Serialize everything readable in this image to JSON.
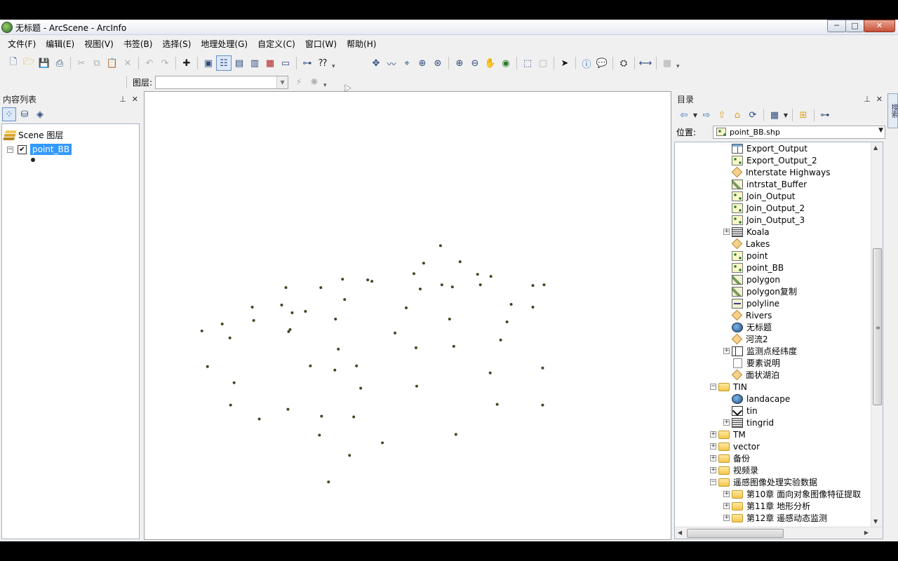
{
  "window": {
    "title": "无标题 - ArcScene - ArcInfo",
    "buttons": {
      "minimize": "─",
      "maximize": "□",
      "close": "✕"
    }
  },
  "menu": [
    "文件(F)",
    "编辑(E)",
    "视图(V)",
    "书签(B)",
    "选择(S)",
    "地理处理(G)",
    "自定义(C)",
    "窗口(W)",
    "帮助(H)"
  ],
  "toolbar": {
    "layer_label": "图层:",
    "layer_value": ""
  },
  "toc": {
    "title": "内容列表",
    "scene_layers": "Scene 图层",
    "layer_name": "point_BB"
  },
  "catalog": {
    "title": "目录",
    "location_label": "位置:",
    "location_value": "point_BB.shp",
    "items": [
      {
        "label": "Export_Output",
        "icon": "table-icon"
      },
      {
        "label": "Export_Output_2",
        "icon": "point-shapefile-icon"
      },
      {
        "label": "Interstate Highways",
        "icon": "layer-file-icon"
      },
      {
        "label": "intrstat_Buffer",
        "icon": "polygon-shapefile-icon"
      },
      {
        "label": "Join_Output",
        "icon": "point-shapefile-icon"
      },
      {
        "label": "Join_Output_2",
        "icon": "point-shapefile-icon"
      },
      {
        "label": "Join_Output_3",
        "icon": "point-shapefile-icon"
      },
      {
        "label": "Koala",
        "icon": "raster-icon"
      },
      {
        "label": "Lakes",
        "icon": "layer-file-icon"
      },
      {
        "label": "point",
        "icon": "point-shapefile-icon"
      },
      {
        "label": "point_BB",
        "icon": "point-shapefile-icon"
      },
      {
        "label": "polygon",
        "icon": "polygon-shapefile-icon"
      },
      {
        "label": "polygon复制",
        "icon": "polygon-shapefile-icon"
      },
      {
        "label": "polyline",
        "icon": "line-shapefile-icon"
      },
      {
        "label": "Rivers",
        "icon": "layer-file-icon"
      },
      {
        "label": "无标题",
        "icon": "globe-icon"
      },
      {
        "label": "河流2",
        "icon": "layer-file-icon"
      },
      {
        "label": "监测点经纬度",
        "icon": "3d-shapefile-icon"
      },
      {
        "label": "要素说明",
        "icon": "document-icon"
      },
      {
        "label": "面状湖泊",
        "icon": "layer-file-icon"
      },
      {
        "label": "TIN",
        "icon": "folder-icon"
      },
      {
        "label": "landacape",
        "icon": "globe-icon"
      },
      {
        "label": "tin",
        "icon": "tin-icon"
      },
      {
        "label": "tingrid",
        "icon": "raster-icon"
      },
      {
        "label": "TM",
        "icon": "folder-icon"
      },
      {
        "label": "vector",
        "icon": "folder-icon"
      },
      {
        "label": "备份",
        "icon": "folder-icon"
      },
      {
        "label": "视频录",
        "icon": "folder-icon"
      },
      {
        "label": "遥感图像处理实验数据",
        "icon": "folder-icon"
      },
      {
        "label": "第10章 面向对象图像特征提取",
        "icon": "folder-icon"
      },
      {
        "label": "第11章 地形分析",
        "icon": "folder-icon"
      },
      {
        "label": "第12章 遥感动态监测",
        "icon": "folder-icon"
      }
    ]
  },
  "side_tab": "搜索",
  "colors": {
    "selection": "#3399ff",
    "point_symbol": "#3c4a24"
  }
}
